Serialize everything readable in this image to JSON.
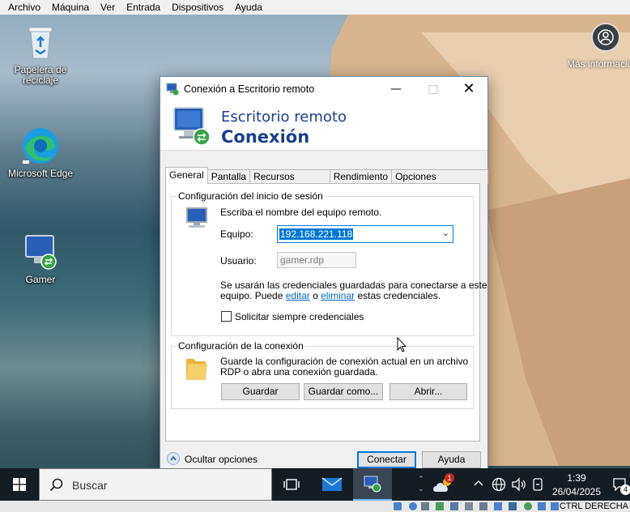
{
  "vm_menu": {
    "items": [
      "Archivo",
      "Máquina",
      "Ver",
      "Entrada",
      "Dispositivos",
      "Ayuda"
    ]
  },
  "desktop": {
    "icons": [
      {
        "label": "Papelera de reciclaje",
        "icon": "recycle-bin-icon"
      },
      {
        "label": "Microsoft Edge",
        "icon": "edge-icon"
      },
      {
        "label": "Gamer",
        "icon": "remote-desktop-shortcut-icon"
      }
    ],
    "info_widget": {
      "label": "Más información sobre esta imagen",
      "icon": "camera-info-icon"
    }
  },
  "window": {
    "title": "Conexión a Escritorio remoto",
    "banner_line1": "Escritorio remoto",
    "banner_line2": "Conexión",
    "tabs": [
      "General",
      "Pantalla",
      "Recursos locales",
      "Rendimiento",
      "Opciones avanzadas"
    ],
    "active_tab": "General",
    "logon": {
      "group_title": "Configuración del inicio de sesión",
      "prompt": "Escriba el nombre del equipo remoto.",
      "computer_label": "Equipo:",
      "computer_value": "192.168.221.118",
      "user_label": "Usuario:",
      "user_value": "gamer.rdp",
      "cred_text_1": "Se usarán las credenciales guardadas para conectarse a este",
      "cred_text_2a": "equipo.  Puede ",
      "cred_link_edit": "editar",
      "cred_text_2b": " o ",
      "cred_link_delete": "eliminar",
      "cred_text_2c": " estas credenciales.",
      "always_ask_label": "Solicitar siempre credenciales",
      "always_ask_checked": false
    },
    "connection": {
      "group_title": "Configuración de la conexión",
      "desc_1": "Guarde la configuración de conexión actual en un archivo",
      "desc_2": "RDP o abra una conexión guardada.",
      "save_label": "Guardar",
      "save_as_label": "Guardar como...",
      "open_label": "Abrir..."
    },
    "hide_options_label": "Ocultar opciones",
    "connect_label": "Conectar",
    "help_label": "Ayuda"
  },
  "taskbar": {
    "search_placeholder": "Buscar",
    "time": "1:39",
    "date": "26/04/2025",
    "notification_count": "4",
    "weather_badge": "1"
  },
  "vm_status": {
    "host_key": "CTRL DERECHA"
  },
  "colors": {
    "accent": "#0078d7",
    "banner_text": "#1a3f8f",
    "taskbar": "#141c24"
  }
}
